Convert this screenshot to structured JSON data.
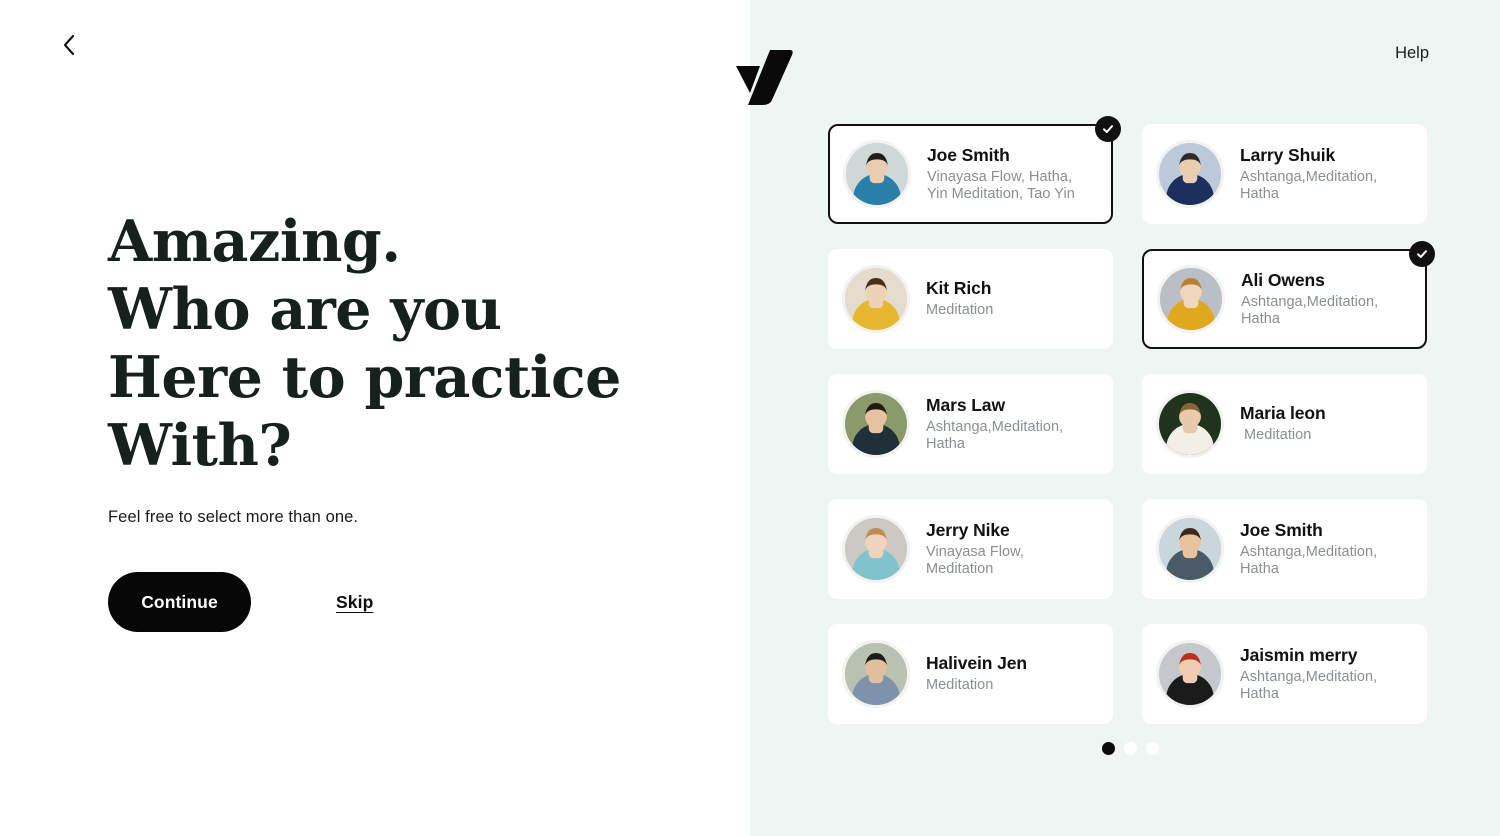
{
  "colors": {
    "panel_mint": "#eef5f3",
    "panel_white": "#ffffff",
    "accent_black": "#0b0b0b",
    "card_white": "#ffffff",
    "tag_gray": "#8a8f92"
  },
  "left": {
    "back_icon": "chevron-left-icon",
    "headline_lines": [
      "Amazing.",
      "Who are you",
      "Here to practice",
      "With?"
    ],
    "subtitle": "Feel free to select more than one.",
    "continue_label": "Continue",
    "skip_label": "Skip"
  },
  "right": {
    "help_label": "Help",
    "logo_icon": "checkmark-logo-icon",
    "pagination": {
      "count": 3,
      "active_index": 0
    },
    "cards": [
      {
        "name": "Joe Smith",
        "tags": "Vinayasa Flow, Hatha,\nYin Meditation, Tao Yin",
        "selected": true,
        "avatar": "man-sunglasses-denim-jacket",
        "indent_tags": false
      },
      {
        "name": "Larry Shuik",
        "tags": "Ashtanga,Meditation,\nHatha",
        "selected": false,
        "avatar": "man-navy-suit-tie",
        "indent_tags": false
      },
      {
        "name": "Kit Rich",
        "tags": "Meditation",
        "selected": false,
        "avatar": "woman-yellow-sweater-long-hair",
        "indent_tags": false
      },
      {
        "name": "Ali Owens",
        "tags": "Ashtanga,Meditation,\nHatha",
        "selected": true,
        "avatar": "woman-yellow-coat-blonde-bob",
        "indent_tags": false
      },
      {
        "name": "Mars Law",
        "tags": "Ashtanga,Meditation,\nHatha",
        "selected": false,
        "avatar": "man-black-scarf-autumn",
        "indent_tags": false
      },
      {
        "name": "Maria leon",
        "tags": "Meditation",
        "selected": false,
        "avatar": "woman-white-blouse-greenery",
        "indent_tags": true
      },
      {
        "name": "Jerry Nike",
        "tags": "Vinayasa Flow,\nMeditation",
        "selected": false,
        "avatar": "woman-teal-off-shoulder-top",
        "indent_tags": false
      },
      {
        "name": "Joe Smith",
        "tags": "Ashtanga,Meditation,\nHatha",
        "selected": false,
        "avatar": "man-bearded-smiling",
        "indent_tags": false
      },
      {
        "name": "Halivein Jen",
        "tags": "Meditation",
        "selected": false,
        "avatar": "man-patterned-jacket-sunglasses",
        "indent_tags": false
      },
      {
        "name": "Jaismin merry",
        "tags": "Ashtanga,Meditation,\nHatha",
        "selected": false,
        "avatar": "woman-red-beret-glasses-stripes",
        "indent_tags": false
      }
    ]
  }
}
